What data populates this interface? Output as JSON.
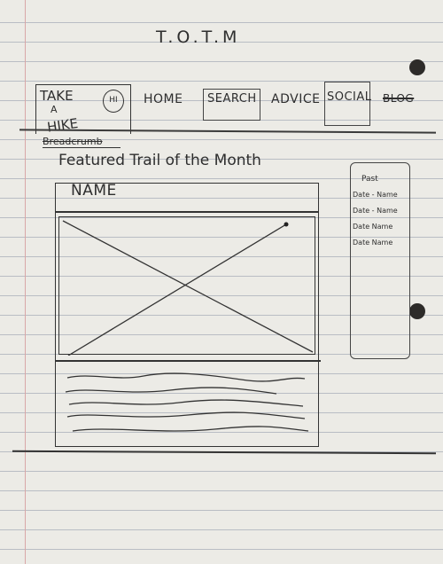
{
  "page": {
    "heading": "T.O.T.M"
  },
  "header": {
    "logo": {
      "line1": "TAKE",
      "line2": "A",
      "line3": "HIKE",
      "smiley_text": "HI"
    },
    "nav": {
      "home": "HOME",
      "search": "SEARCH",
      "advice": "ADVICE",
      "social": "SOCIAL",
      "blog": "BLOG"
    }
  },
  "breadcrumb": "Breadcrumb",
  "main": {
    "title": "Featured Trail of the Month",
    "card": {
      "name": "NAME"
    }
  },
  "sidebar": {
    "heading": "Past",
    "items": [
      "Date - Name",
      "Date - Name",
      "Date Name",
      "Date Name"
    ]
  },
  "colors": {
    "ink": "#2e2e2e",
    "paper": "#ecebe6",
    "rule_lines": "#b9bdc4",
    "margin_line": "#d9a7a7"
  }
}
